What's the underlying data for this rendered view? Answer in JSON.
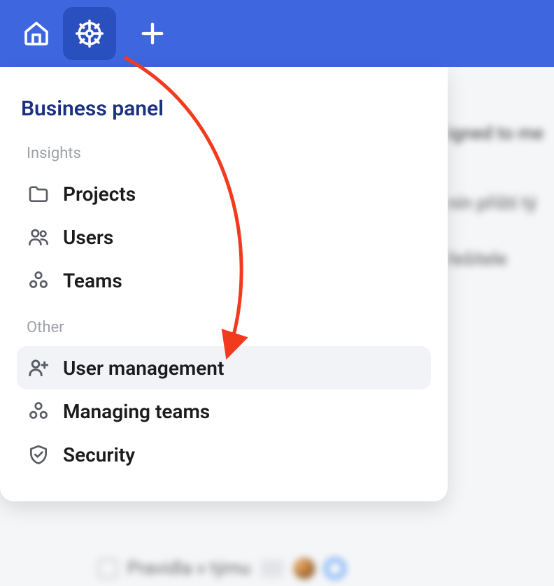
{
  "topbar": {
    "home_label": "Home",
    "gear_label": "Business panel",
    "plus_label": "Add"
  },
  "panel": {
    "title": "Business panel",
    "sections": [
      {
        "label": "Insights",
        "items": [
          {
            "label": "Projects"
          },
          {
            "label": "Users"
          },
          {
            "label": "Teams"
          }
        ]
      },
      {
        "label": "Other",
        "items": [
          {
            "label": "User management"
          },
          {
            "label": "Managing teams"
          },
          {
            "label": "Security"
          }
        ]
      }
    ]
  },
  "background": {
    "row1": "igned to me",
    "row2": "nín příští tý",
    "row3": "řešitele",
    "bottom_text": "Pravidla v týmu"
  },
  "colors": {
    "accent": "#3E66DE",
    "accent_dark": "#2A50BF",
    "panel_title": "#1B3082",
    "annotation": "#F23A1D"
  }
}
